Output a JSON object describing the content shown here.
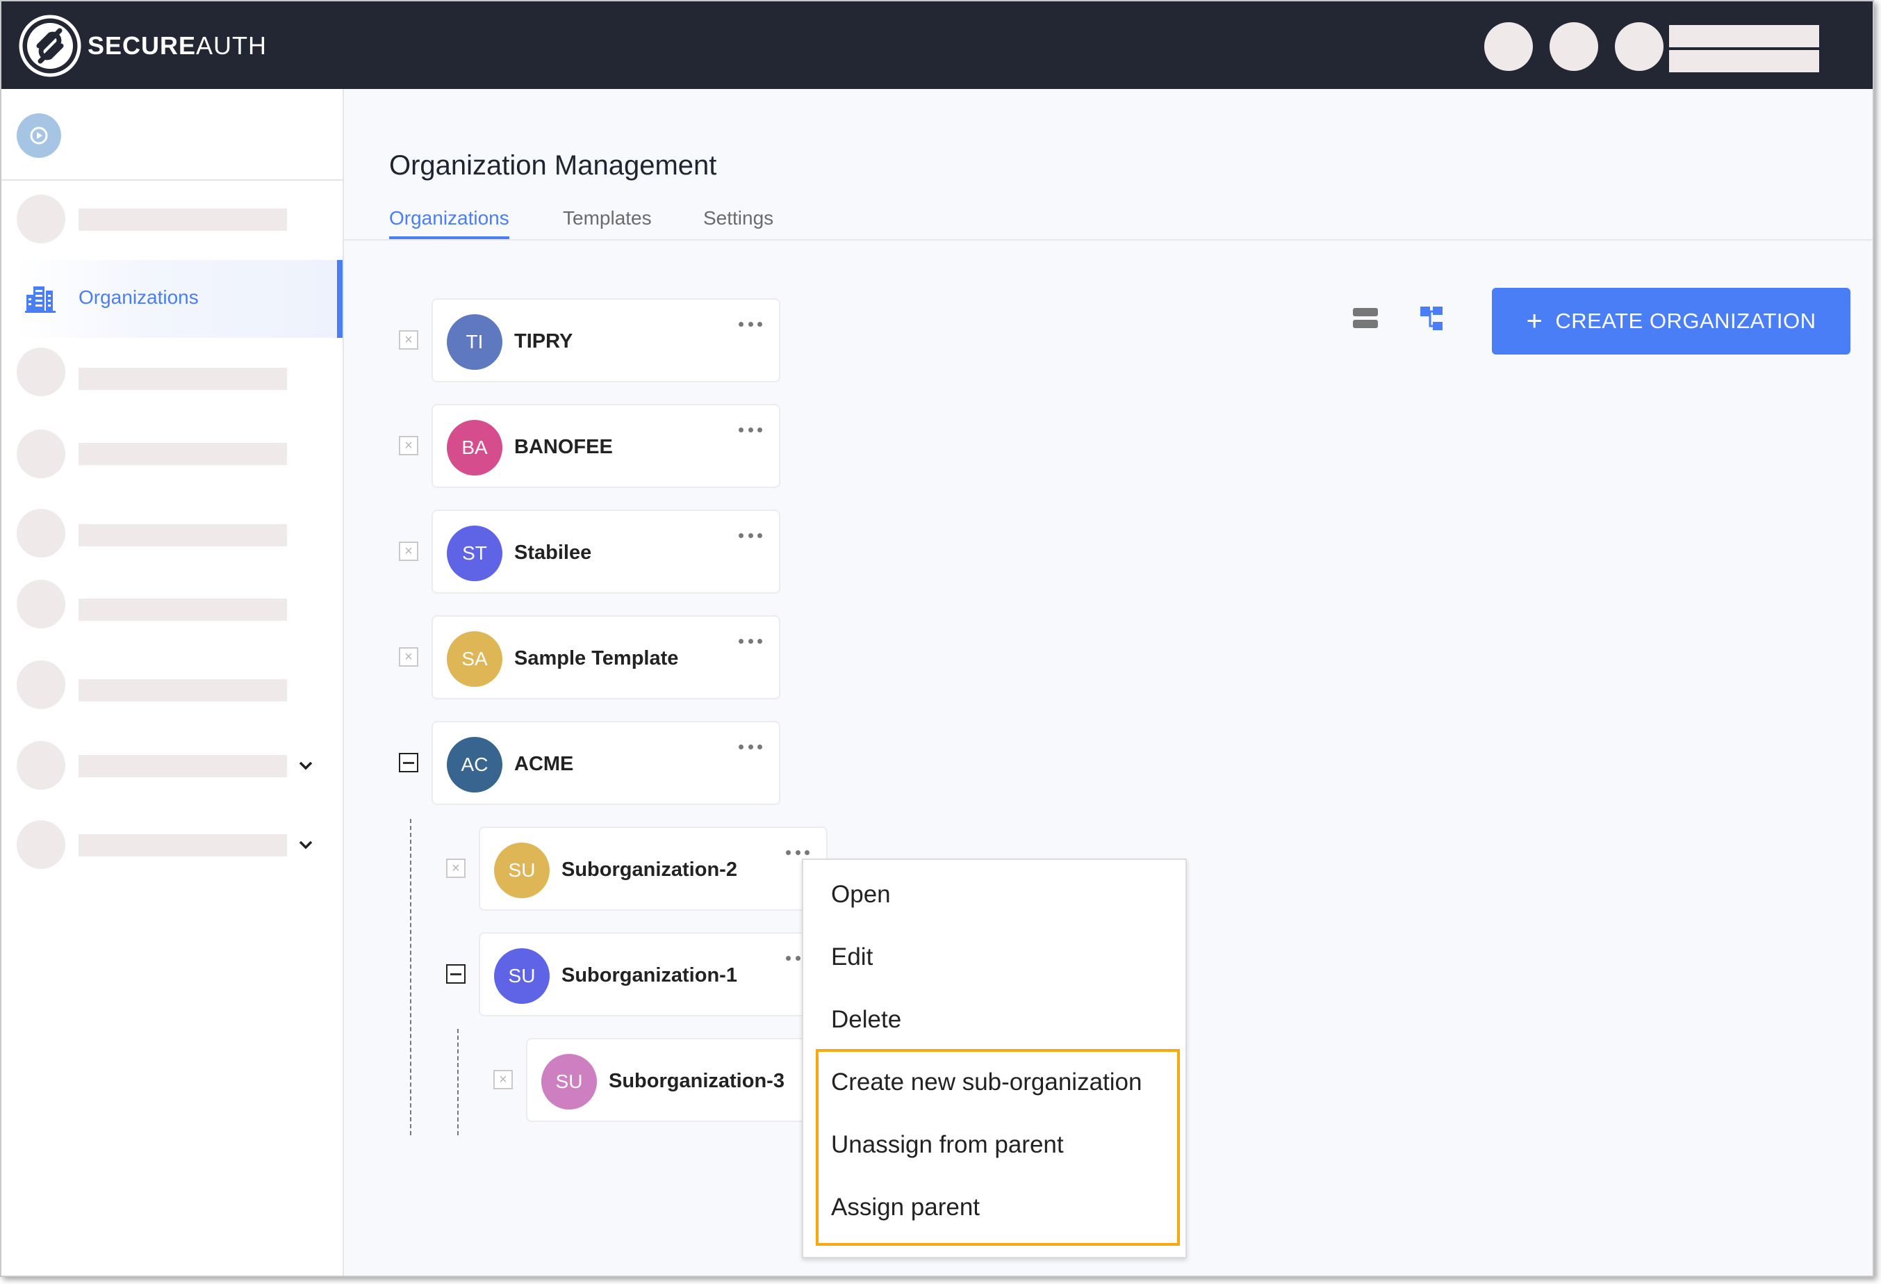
{
  "header": {
    "brand_bold": "SECURE",
    "brand_light": "AUTH",
    "colors": {
      "background": "#232633"
    }
  },
  "sidebar": {
    "active_item": {
      "label": "Organizations",
      "icon": "building-icon"
    },
    "placeholder_items": 8,
    "colors": {
      "accent": "#4a7ef6"
    }
  },
  "page": {
    "title": "Organization Management",
    "tabs": [
      {
        "label": "Organizations",
        "active": true
      },
      {
        "label": "Templates",
        "active": false
      },
      {
        "label": "Settings",
        "active": false
      }
    ]
  },
  "toolbar": {
    "list_view_icon": "list-view-icon",
    "tree_view_icon": "tree-view-icon",
    "create_button": {
      "icon": "+",
      "label": "CREATE ORGANIZATION"
    }
  },
  "organizations": [
    {
      "initials": "TI",
      "name": "TIPRY",
      "color": "#5f79c1",
      "level": 0,
      "expanded": false
    },
    {
      "initials": "BA",
      "name": "BANOFEE",
      "color": "#d64d8e",
      "level": 0,
      "expanded": false
    },
    {
      "initials": "ST",
      "name": "Stabilee",
      "color": "#5f63e6",
      "level": 0,
      "expanded": false
    },
    {
      "initials": "SA",
      "name": "Sample Template",
      "color": "#dfb655",
      "level": 0,
      "expanded": false
    },
    {
      "initials": "AC",
      "name": "ACME",
      "color": "#386590",
      "level": 0,
      "expanded": true
    },
    {
      "initials": "SU",
      "name": "Suborganization-2",
      "color": "#dfb655",
      "level": 1,
      "expanded": false
    },
    {
      "initials": "SU",
      "name": "Suborganization-1",
      "color": "#5f63e6",
      "level": 1,
      "expanded": true
    },
    {
      "initials": "SU",
      "name": "Suborganization-3",
      "color": "#ce7fc1",
      "level": 2,
      "expanded": false
    }
  ],
  "context_menu": {
    "items": [
      "Open",
      "Edit",
      "Delete",
      "Create new sub-organization",
      "Unassign from parent",
      "Assign parent"
    ],
    "highlight_color": "#f9a80e"
  }
}
